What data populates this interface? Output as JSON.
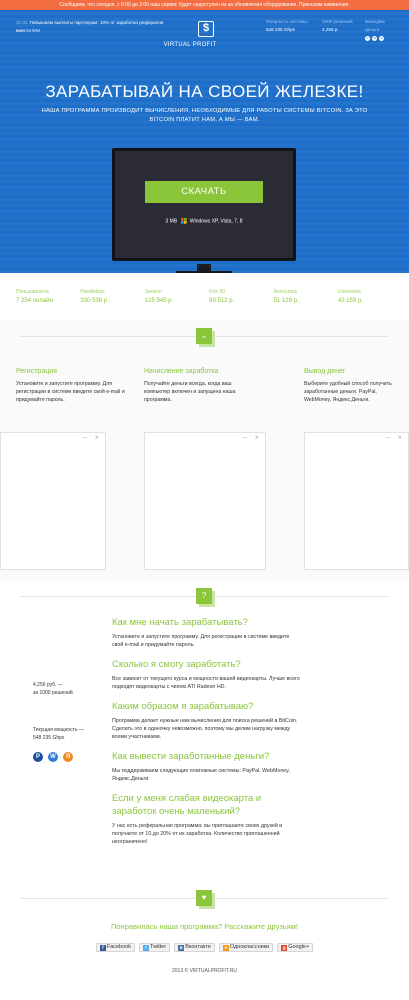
{
  "alert": "Сообщаем, что сегодня, с 0:00 до 2:00 наш сервис будет недоступен из-за обновления оборудования. Приносим извинения.",
  "news": {
    "date": "31.04",
    "text": "Повышаем выплаты партнерам: 10% от заработка рефералов вместо 5%!"
  },
  "logo": {
    "glyph": "$",
    "name": "VIRTUAL PROFIT"
  },
  "top_stats": [
    {
      "label": "Мощность системы",
      "value": "548 235 Ghps"
    },
    {
      "label": "1000 решений",
      "value": "4,256 р."
    },
    {
      "label": "Выводим деньги",
      "value": ""
    }
  ],
  "pay_icons": [
    "paypal-icon",
    "webmoney-icon",
    "yandex-money-icon"
  ],
  "hero": {
    "headline": "ЗАРАБАТЫВАЙ НА СВОЕЙ ЖЕЛЕЗКЕ!",
    "subline": "НАША ПРОГРАММА ПРОИЗВОДИТ ВЫЧИСЛЕНИЯ, НЕОБХОДИМЫЕ ДЛЯ РАБОТЫ СИСТЕМЫ BITCOIN. ЗА ЭТО BITCOIN ПЛАТИТ НАМ, А МЫ — ВАМ.",
    "download_label": "СКАЧАТЬ",
    "size": "3 MB",
    "os": "Windows XP, Vista, 7, 8"
  },
  "users": [
    {
      "name": "Пользователи",
      "value": "7 254 онлайн"
    },
    {
      "name": "Parallelsss",
      "value": "330 536 р."
    },
    {
      "name": "Sevenn",
      "value": "125 945 р."
    },
    {
      "name": "Kira 90",
      "value": "89 512 р."
    },
    {
      "name": "Anonymus",
      "value": "51 129 р."
    },
    {
      "name": "Username",
      "value": "42 159 р."
    }
  ],
  "badge_chevron": "⌄",
  "steps": [
    {
      "title": "Регистрация",
      "text": "Установите и запустите программу. Для регистрации в системе введите свой e-mail и придумайте пароль."
    },
    {
      "title": "Начисление заработка",
      "text": "Получайте деньги всегда, когда ваш компьютер включен и запущена наша программа."
    },
    {
      "title": "Вывод денег",
      "text": "Выберите удобный способ получить заработанные деньги. PayPal, WebMoney, Яндекс.Деньги."
    }
  ],
  "ad_controls": "— ✕",
  "badge_question": "?",
  "faq": [
    {
      "q": "Как мне начать зарабатывать?",
      "a": "Установите и запустите программу. Для регистрации в системе введите свой e-mail и придумайте пароль."
    },
    {
      "q": "Сколько я смогу заработать?",
      "a": "Все зависит от текущего курса и мощности вашей видеокарты. Лучше всего подходят видеокарты с чипом ATI Radeon HD."
    },
    {
      "q": "Каким образом я зарабатываю?",
      "a": "Программа делает нужные нам вычисления для поиска решений в BitCoin. Сделать это в одиночку невозможно, поэтому мы делим нагрузку между всеми участниками."
    },
    {
      "q": "Как вывести заработанные деньги?",
      "a": "Мы поддерживаем следующие платежные системы: PayPal, WebMoney, Яндекс.Деньги"
    },
    {
      "q": "Если у меня слабая видеокарта и заработок очень маленький?",
      "a": "У нас есть реферальная программа: вы приглашаете своих друзей и получаете от 10 до 20% от их заработка. Количество приглашенний неограничено!"
    }
  ],
  "side": {
    "earn_line1": "4,256 руб. —",
    "earn_line2": "за 1000 решений",
    "power_line1": "Текущая мощность —",
    "power_line2": "548 235 Ghps"
  },
  "badge_heart": "♥",
  "share": {
    "title": "Понравилась наша программа? Расскажите друзьям!",
    "buttons": [
      {
        "icon": "f",
        "label": "Facebook",
        "color": "#3b5998"
      },
      {
        "icon": "t",
        "label": "Twitter",
        "color": "#55acee"
      },
      {
        "icon": "в",
        "label": "Вконтакте",
        "color": "#4c75a3"
      },
      {
        "icon": "о",
        "label": "Одноклассники",
        "color": "#f39a1c"
      },
      {
        "icon": "g",
        "label": "Google+",
        "color": "#dd4b39"
      }
    ]
  },
  "footer": "2013 © VIRTUALPROFIT.RU"
}
